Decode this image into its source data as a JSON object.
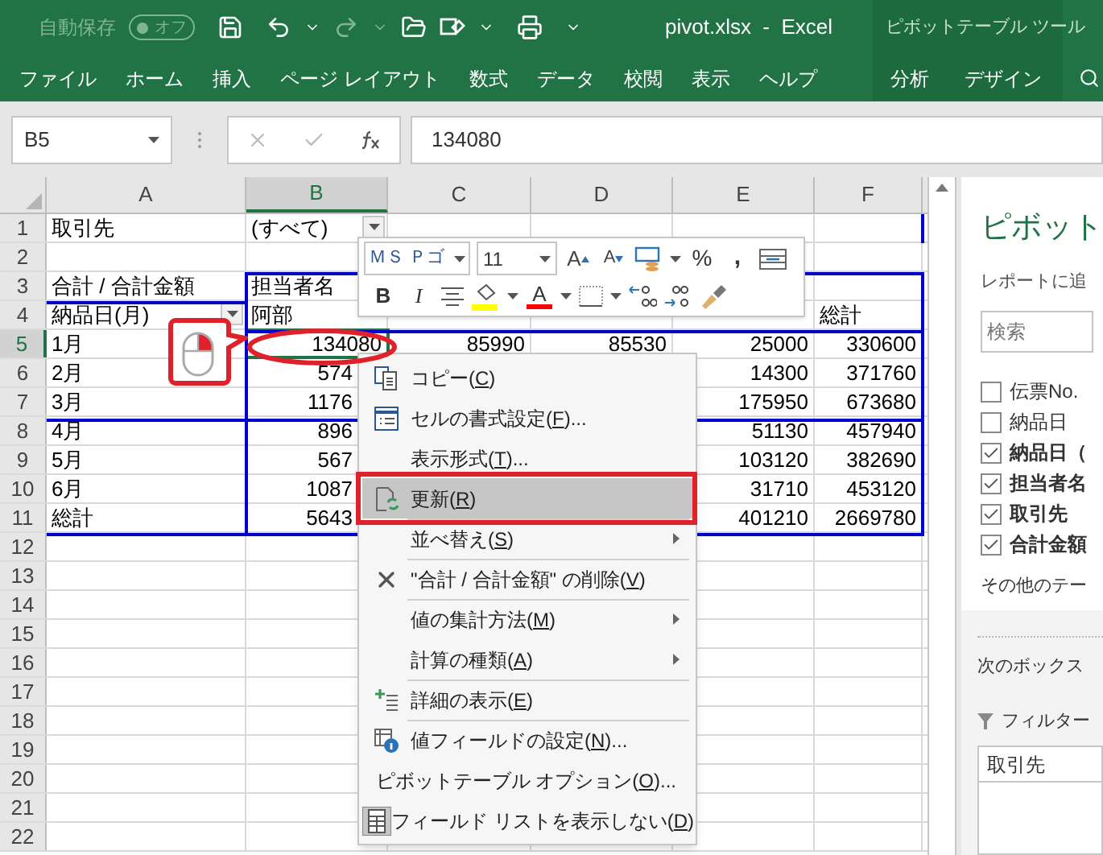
{
  "title_bar": {
    "autosave_label": "自動保存",
    "autosave_toggle": {
      "label": "オフ",
      "on": false
    },
    "document_title": "pivot.xlsx  -  Excel",
    "context_title": "ピボットテーブル ツール"
  },
  "ribbon_tabs": [
    {
      "label": "ファイル",
      "kind": "standard"
    },
    {
      "label": "ホーム",
      "kind": "standard"
    },
    {
      "label": "挿入",
      "kind": "standard"
    },
    {
      "label": "ページ レイアウト",
      "kind": "standard"
    },
    {
      "label": "数式",
      "kind": "standard"
    },
    {
      "label": "データ",
      "kind": "standard"
    },
    {
      "label": "校閲",
      "kind": "standard"
    },
    {
      "label": "表示",
      "kind": "standard"
    },
    {
      "label": "ヘルプ",
      "kind": "standard"
    },
    {
      "label": "分析",
      "kind": "contextual"
    },
    {
      "label": "デザイン",
      "kind": "contextual"
    }
  ],
  "formula_bar": {
    "name_box": "B5",
    "value": "134080"
  },
  "columns": [
    {
      "label": "A",
      "selected": false
    },
    {
      "label": "B",
      "selected": true
    },
    {
      "label": "C",
      "selected": false
    },
    {
      "label": "D",
      "selected": false
    },
    {
      "label": "E",
      "selected": false
    },
    {
      "label": "F",
      "selected": false
    }
  ],
  "rows": [
    {
      "number": "1",
      "selected": false,
      "kind": "header",
      "cells": {
        "A": {
          "text": "取引先"
        },
        "B": {
          "text": "(すべて)",
          "dropdown": true
        }
      }
    },
    {
      "number": "2",
      "selected": false,
      "kind": "header"
    },
    {
      "number": "3",
      "selected": false,
      "kind": "header",
      "cells": {
        "A": {
          "text": "合計 / 合計金額"
        },
        "B": {
          "text": "担当者名"
        }
      }
    },
    {
      "number": "4",
      "selected": false,
      "kind": "header",
      "cells": {
        "A": {
          "text": "納品日(月)",
          "dropdown": true
        },
        "B": {
          "text": "阿部"
        },
        "F": {
          "text": "総計"
        }
      }
    },
    {
      "number": "5",
      "selected": true,
      "kind": "values",
      "cells": {
        "A": {
          "text": "1月"
        },
        "B": {
          "text": "134080",
          "active": true
        },
        "C": {
          "text": "85990"
        },
        "D": {
          "text": "85530"
        },
        "E": {
          "text": "25000"
        },
        "F": {
          "text": "330600"
        }
      }
    },
    {
      "number": "6",
      "selected": false,
      "kind": "values",
      "cells": {
        "A": {
          "text": "2月"
        },
        "B": {
          "text": "574"
        },
        "E": {
          "text": "14300"
        },
        "F": {
          "text": "371760"
        }
      }
    },
    {
      "number": "7",
      "selected": false,
      "kind": "values",
      "cells": {
        "A": {
          "text": "3月"
        },
        "B": {
          "text": "1176"
        },
        "E": {
          "text": "175950"
        },
        "F": {
          "text": "673680"
        }
      }
    },
    {
      "number": "8",
      "selected": false,
      "kind": "values",
      "cells": {
        "A": {
          "text": "4月"
        },
        "B": {
          "text": "896"
        },
        "E": {
          "text": "51130"
        },
        "F": {
          "text": "457940"
        }
      }
    },
    {
      "number": "9",
      "selected": false,
      "kind": "values",
      "cells": {
        "A": {
          "text": "5月"
        },
        "B": {
          "text": "567"
        },
        "E": {
          "text": "103120"
        },
        "F": {
          "text": "382690"
        }
      }
    },
    {
      "number": "10",
      "selected": false,
      "kind": "values",
      "cells": {
        "A": {
          "text": "6月"
        },
        "B": {
          "text": "1087"
        },
        "E": {
          "text": "31710"
        },
        "F": {
          "text": "453120"
        }
      }
    },
    {
      "number": "11",
      "selected": false,
      "kind": "values",
      "cells": {
        "A": {
          "text": "総計"
        },
        "B": {
          "text": "5643"
        },
        "E": {
          "text": "401210"
        },
        "F": {
          "text": "2669780"
        }
      }
    },
    {
      "number": "12",
      "selected": false,
      "kind": "header"
    },
    {
      "number": "13",
      "selected": false,
      "kind": "header"
    },
    {
      "number": "14",
      "selected": false,
      "kind": "header"
    },
    {
      "number": "15",
      "selected": false,
      "kind": "header"
    },
    {
      "number": "16",
      "selected": false,
      "kind": "header"
    },
    {
      "number": "17",
      "selected": false,
      "kind": "header"
    },
    {
      "number": "18",
      "selected": false,
      "kind": "header"
    },
    {
      "number": "19",
      "selected": false,
      "kind": "header"
    },
    {
      "number": "20",
      "selected": false,
      "kind": "header"
    },
    {
      "number": "21",
      "selected": false,
      "kind": "header"
    },
    {
      "number": "22",
      "selected": false,
      "kind": "header"
    }
  ],
  "mini_toolbar": {
    "font": "ＭＳ Ｐゴ",
    "size": "11",
    "grow_font": "A",
    "shrink_font": "A",
    "percent": "%",
    "comma": ",",
    "bold": "B",
    "italic": "I",
    "font_color": "A"
  },
  "context_menu": [
    {
      "label": "コピー(",
      "accel": "C",
      "tail": ")",
      "kind": "copy",
      "selected": false,
      "submenu": false,
      "separator_before": false
    },
    {
      "label": "セルの書式設定(",
      "accel": "F",
      "tail": ")...",
      "kind": "format",
      "selected": false,
      "submenu": false,
      "separator_before": false
    },
    {
      "label": "表示形式(",
      "accel": "T",
      "tail": ")...",
      "kind": "plain",
      "selected": false,
      "submenu": false,
      "separator_before": false
    },
    {
      "label": "更新(",
      "accel": "R",
      "tail": ")",
      "kind": "refresh",
      "selected": true,
      "submenu": false,
      "separator_before": false
    },
    {
      "label": "並べ替え(",
      "accel": "S",
      "tail": ")",
      "kind": "plain",
      "selected": false,
      "submenu": true,
      "separator_before": true
    },
    {
      "label": "\"合計 / 合計金額\" の削除(",
      "accel": "V",
      "tail": ")",
      "kind": "delete",
      "selected": false,
      "submenu": false,
      "separator_before": true
    },
    {
      "label": "値の集計方法(",
      "accel": "M",
      "tail": ")",
      "kind": "plain",
      "selected": false,
      "submenu": true,
      "separator_before": true
    },
    {
      "label": "計算の種類(",
      "accel": "A",
      "tail": ")",
      "kind": "plain",
      "selected": false,
      "submenu": true,
      "separator_before": false
    },
    {
      "label": "詳細の表示(",
      "accel": "E",
      "tail": ")",
      "kind": "detail",
      "selected": false,
      "submenu": false,
      "separator_before": true
    },
    {
      "label": "値フィールドの設定(",
      "accel": "N",
      "tail": ")...",
      "kind": "field-settings",
      "selected": false,
      "submenu": false,
      "separator_before": true
    },
    {
      "label": "ピボットテーブル オプション(",
      "accel": "O",
      "tail": ")...",
      "kind": "plain",
      "selected": false,
      "submenu": false,
      "separator_before": false
    },
    {
      "label": "フィールド リストを表示しない(",
      "accel": "D",
      "tail": ")",
      "kind": "field-list",
      "selected": false,
      "submenu": false,
      "separator_before": false
    }
  ],
  "pivot_pane": {
    "title": "ピボット",
    "subtitle": "レポートに追",
    "search": {
      "placeholder": "検索"
    },
    "fields": [
      {
        "label": "伝票No.",
        "checked": false
      },
      {
        "label": "納品日",
        "checked": false
      },
      {
        "label": "納品日（",
        "checked": true
      },
      {
        "label": "担当者名",
        "checked": true
      },
      {
        "label": "取引先",
        "checked": true
      },
      {
        "label": "合計金額",
        "checked": true
      }
    ],
    "more_tables": "その他のテー",
    "areas_hint": "次のボックス",
    "filter_label": "フィルター",
    "filter_items": [
      "取引先"
    ]
  }
}
